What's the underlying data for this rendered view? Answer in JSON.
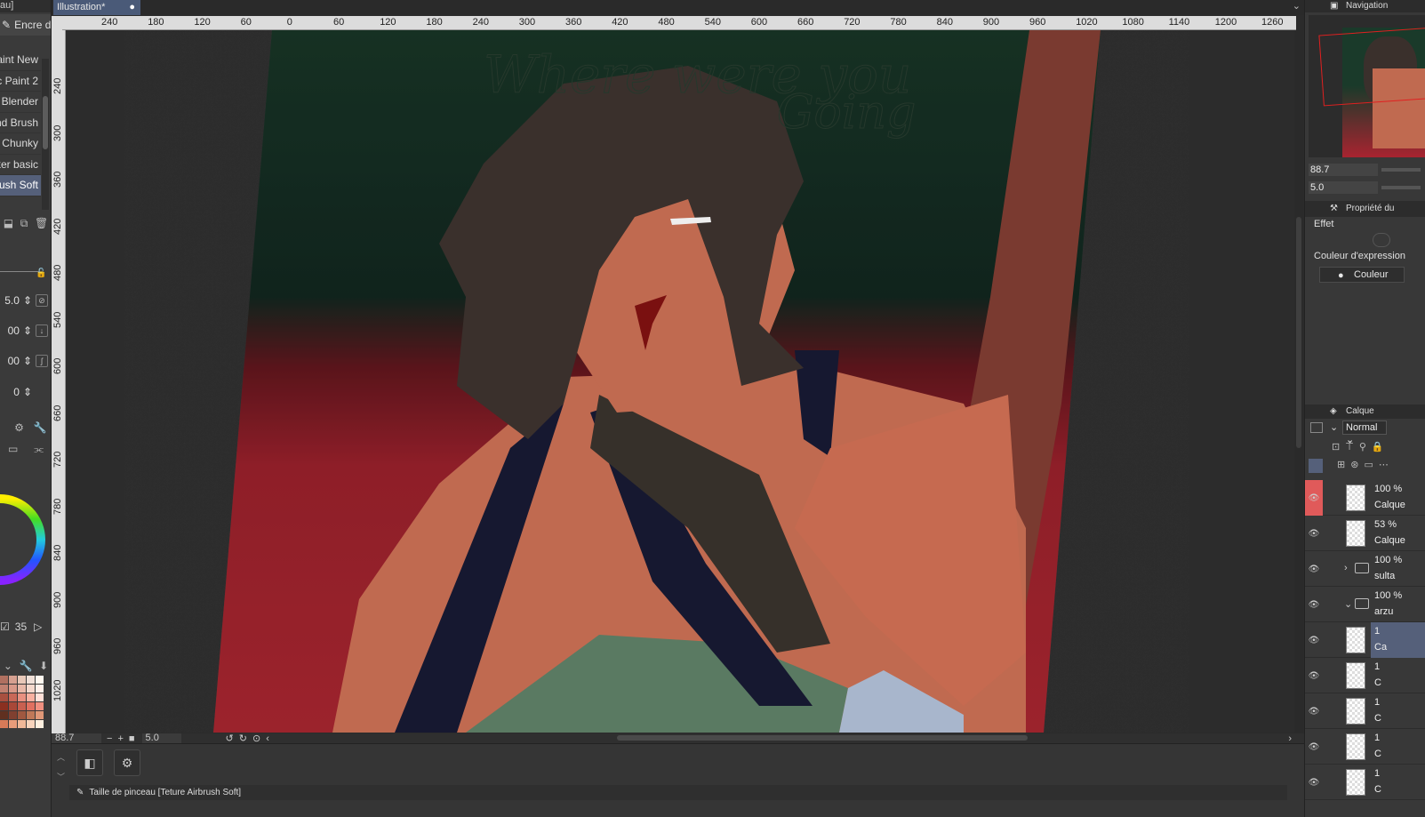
{
  "left_panel": {
    "top_label": "au]",
    "tool_tab": "Encre d",
    "brushes": [
      {
        "label": "aint New",
        "selected": false
      },
      {
        "label": "c Paint 2",
        "selected": false
      },
      {
        "label": "t Blender",
        "selected": false
      },
      {
        "label": "nd Brush",
        "selected": false
      },
      {
        "label": "t Chunky",
        "selected": false
      },
      {
        "label": "ker basic",
        "selected": false
      },
      {
        "label": "rush Soft",
        "selected": true
      }
    ],
    "params": [
      "5.0",
      "00",
      "00",
      "0"
    ],
    "color_value": "35",
    "swatch_colors": [
      "#b07060",
      "#d6a090",
      "#e8c8b8",
      "#f0e0d8",
      "#fff8f0",
      "#c08070",
      "#d89888",
      "#e8b8a8",
      "#f4d8cc",
      "#fff0ea",
      "#a85040",
      "#c86858",
      "#e89080",
      "#f8b0a0",
      "#ffe0d8",
      "#8a3020",
      "#a84838",
      "#c86050",
      "#e07060",
      "#f09080",
      "#603020",
      "#804030",
      "#a05840",
      "#c07858",
      "#e09878",
      "#d87a58",
      "#e89c7a",
      "#f0b898",
      "#f8d4bc",
      "#fff0e0"
    ]
  },
  "tabs": {
    "document_tab": "Illustration*",
    "tab_dot": "●"
  },
  "rulers": {
    "horizontal": [
      "240",
      "180",
      "120",
      "60",
      "0",
      "60",
      "120",
      "180",
      "240",
      "300",
      "360",
      "420",
      "480",
      "540",
      "600",
      "660",
      "720",
      "780",
      "840",
      "900",
      "960",
      "1020",
      "1080",
      "1140",
      "1200",
      "1260"
    ],
    "vertical": [
      "240",
      "300",
      "360",
      "420",
      "480",
      "540",
      "600",
      "660",
      "720",
      "780",
      "840",
      "900",
      "960",
      "1020",
      "80"
    ]
  },
  "status": {
    "zoom": "88.7",
    "rotation": "5.0",
    "message": "Taille de pinceau [Teture Airbrush Soft]"
  },
  "right_panel": {
    "navigation_title": "Navigation",
    "nav_zoom": "88.7",
    "nav_rotation": "5.0",
    "property_title": "Propriété du",
    "effect_label": "Effet",
    "expression_label": "Couleur d'expression",
    "color_button": "Couleur",
    "layer_title": "Calque",
    "blend_mode": "Normal",
    "layers": [
      {
        "opacity": "100 %",
        "name": "Calque",
        "red": true,
        "selected": false,
        "folder": false
      },
      {
        "opacity": "53 %",
        "name": "Calque",
        "red": false,
        "selected": false,
        "folder": false
      },
      {
        "opacity": "100 %",
        "name": "sulta",
        "red": false,
        "selected": false,
        "folder": true
      },
      {
        "opacity": "100 %",
        "name": "arzu",
        "red": false,
        "selected": false,
        "folder": true
      },
      {
        "opacity": "1",
        "name": "Ca",
        "red": false,
        "selected": true,
        "folder": false
      },
      {
        "opacity": "1",
        "name": "C",
        "red": false,
        "selected": false,
        "folder": false
      },
      {
        "opacity": "1",
        "name": "C",
        "red": false,
        "selected": false,
        "folder": false
      },
      {
        "opacity": "1",
        "name": "C",
        "red": false,
        "selected": false,
        "folder": false
      },
      {
        "opacity": "1",
        "name": "C",
        "red": false,
        "selected": false,
        "folder": false
      }
    ]
  },
  "artwork": {
    "sketch_text_1": "Where were you",
    "sketch_text_2": "Going"
  }
}
